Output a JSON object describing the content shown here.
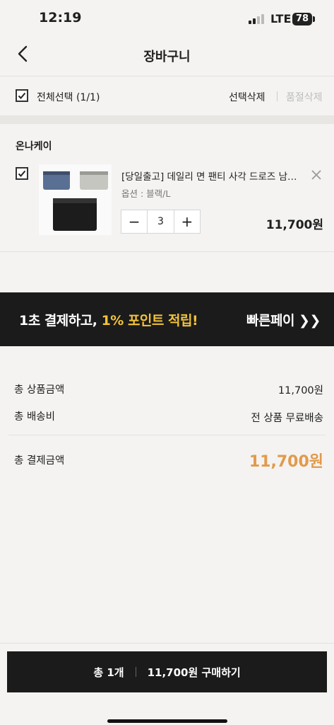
{
  "status_bar": {
    "time": "12:19",
    "network": "LTE",
    "battery": "78"
  },
  "header": {
    "title": "장바구니",
    "back_icon": "chevron-left-icon"
  },
  "selection": {
    "select_all_label": "전체선택 (1/1)",
    "delete_selected": "선택삭제",
    "delete_sold_out": "품절삭제"
  },
  "seller": {
    "name": "온나케이"
  },
  "item": {
    "name": "[당일출고]  데일리 면 팬티 사각 드로즈 남성 속옷",
    "option": "옵션 : 블랙/L",
    "quantity": "3",
    "minus": "−",
    "plus": "+",
    "price": "11,700원",
    "thumbnail_colors": [
      "#5a6f94",
      "#c6c6c1",
      "#1c1c1c"
    ]
  },
  "banner": {
    "text_prefix": "1초 결제하고, ",
    "text_highlight": "1% 포인트 적립!",
    "pay_label": "빠른페이 ❯❯"
  },
  "summary": {
    "product_total_label": "총 상품금액",
    "product_total_value": "11,700원",
    "shipping_label": "총 배송비",
    "shipping_value": "전 상품 무료배송",
    "payment_total_label": "총 결제금액",
    "payment_total_value": "11,700원"
  },
  "footer": {
    "count": "총 1개",
    "buy_label": "11,700원 구매하기"
  },
  "colors": {
    "accent": "#e19a4c",
    "banner_highlight": "#f2c23a",
    "dark": "#1b1b1b"
  }
}
